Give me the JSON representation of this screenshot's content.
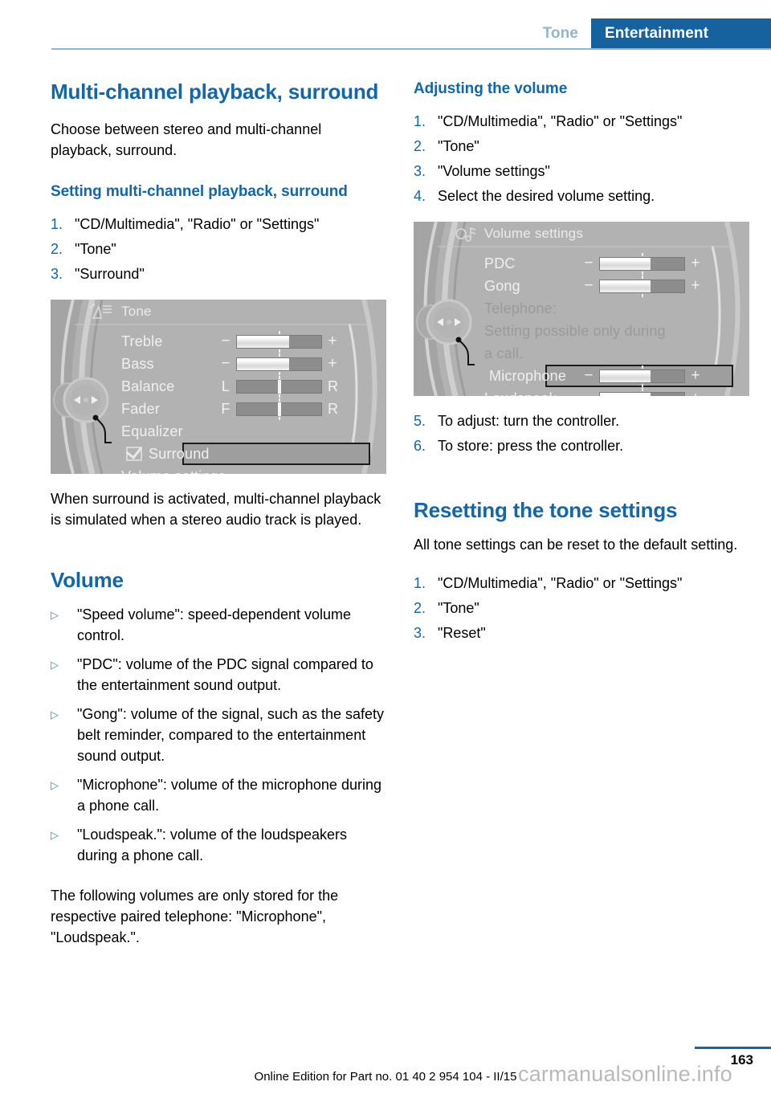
{
  "header": {
    "tab_inactive": "Tone",
    "tab_active": "Entertainment",
    "accent_color": "#16629f",
    "inactive_color": "#93b4d2"
  },
  "left_column": {
    "chapter_title": "Multi-channel playback, surround",
    "intro": "Choose between stereo and multi-channel playback, surround.",
    "section_setting": {
      "heading": "Setting multi-channel playback, surround",
      "steps": [
        {
          "num": "1.",
          "text": "\"CD/Multimedia\", \"Radio\" or \"Settings\""
        },
        {
          "num": "2.",
          "text": "\"Tone\""
        },
        {
          "num": "3.",
          "text": "\"Surround\""
        }
      ]
    },
    "tone_screen": {
      "title": "Tone",
      "icon": "tone-speaker-icon",
      "rows": [
        {
          "label": "Treble",
          "type": "plusminus",
          "minus": "−",
          "plus": "+",
          "fill_pct": 62
        },
        {
          "label": "Bass",
          "type": "plusminus",
          "minus": "−",
          "plus": "+",
          "fill_pct": 62
        },
        {
          "label": "Balance",
          "type": "lr",
          "left": "L",
          "right": "R",
          "knob_pct": 50
        },
        {
          "label": "Fader",
          "type": "lr",
          "left": "F",
          "right": "R",
          "knob_pct": 50
        },
        {
          "label": "Equalizer",
          "type": "plain"
        },
        {
          "label": "Surround",
          "type": "checkbox",
          "checked": true,
          "highlighted": true
        },
        {
          "label": "Volume settings",
          "type": "plain"
        }
      ]
    },
    "after_image": "When surround is activated, multi-channel playback is simulated when a stereo audio track is played.",
    "volume_heading": "Volume",
    "volume_bullets": [
      "\"Speed volume\": speed-dependent volume control.",
      "\"PDC\": volume of the PDC signal compared to the entertainment sound output.",
      "\"Gong\": volume of the signal, such as the safety belt reminder, compared to the entertainment sound output.",
      "\"Microphone\": volume of the microphone during a phone call.",
      "\"Loudspeak.\": volume of the loudspeakers during a phone call."
    ],
    "closing": "The following volumes are only stored for the respective paired telephone: \"Microphone\", \"Loudspeak.\"."
  },
  "right_column": {
    "adjusting_heading": "Adjusting the volume",
    "adjusting_steps_a": [
      {
        "num": "1.",
        "text": "\"CD/Multimedia\", \"Radio\" or \"Settings\""
      },
      {
        "num": "2.",
        "text": "\"Tone\""
      },
      {
        "num": "3.",
        "text": "\"Volume settings\""
      },
      {
        "num": "4.",
        "text": "Select the desired volume setting."
      }
    ],
    "volume_screen": {
      "title": "Volume settings",
      "icon": "volume-note-icon",
      "rows": [
        {
          "label": "PDC",
          "type": "plusminus",
          "minus": "−",
          "plus": "+",
          "fill_pct": 60
        },
        {
          "label": "Gong",
          "type": "plusminus",
          "minus": "−",
          "plus": "+",
          "fill_pct": 60
        },
        {
          "label": "Telephone:",
          "type": "plain",
          "dim": true
        },
        {
          "label": "Setting possible only during",
          "type": "plain",
          "dim": true
        },
        {
          "label": "a call.",
          "type": "plain",
          "dim": true
        },
        {
          "label": "Microphone",
          "type": "plusminus",
          "minus": "−",
          "plus": "+",
          "fill_pct": 60,
          "highlighted": true
        },
        {
          "label": "Loudspeak.",
          "type": "plusminus",
          "minus": "−",
          "plus": "+",
          "fill_pct": 60
        }
      ]
    },
    "adjusting_steps_b": [
      {
        "num": "5.",
        "text": "To adjust: turn the controller."
      },
      {
        "num": "6.",
        "text": "To store: press the controller."
      }
    ],
    "reset_heading": "Resetting the tone settings",
    "reset_intro": "All tone settings can be reset to the default setting.",
    "reset_steps": [
      {
        "num": "1.",
        "text": "\"CD/Multimedia\", \"Radio\" or \"Settings\""
      },
      {
        "num": "2.",
        "text": "\"Tone\""
      },
      {
        "num": "3.",
        "text": "\"Reset\""
      }
    ]
  },
  "footer": {
    "page_number": "163",
    "edition": "Online Edition for Part no. 01 40 2 954 104 - II/15",
    "watermark": "carmanualsonline.info"
  }
}
